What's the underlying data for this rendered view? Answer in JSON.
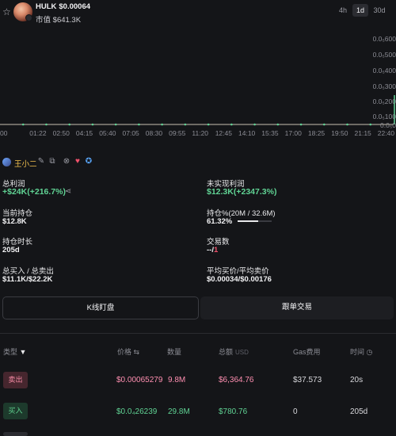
{
  "header": {
    "ticker": "HULK",
    "price": "$0.00064",
    "market_cap_label": "市值",
    "market_cap": "$641.3K",
    "timeframes": [
      "4h",
      "1d",
      "30d"
    ],
    "active_timeframe": "1d"
  },
  "chart_data": {
    "type": "line",
    "title": "",
    "x_ticks": [
      "00",
      "01:22",
      "02:50",
      "04:15",
      "05:40",
      "07:05",
      "08:30",
      "09:55",
      "11:20",
      "12:45",
      "14:10",
      "15:35",
      "17:00",
      "18:25",
      "19:50",
      "21:15",
      "22:40"
    ],
    "y_ticks": [
      "0.0₅600",
      "0.0₅500",
      "0.0₅400",
      "0.0₅300",
      "0.0₅200",
      "0.0₅100",
      "0.0₅0"
    ],
    "series": [
      {
        "values": [
          0,
          0,
          0,
          0,
          0,
          0,
          0,
          0,
          0,
          0,
          0,
          0,
          0,
          0,
          0,
          0,
          0,
          0
        ]
      }
    ],
    "grid": false,
    "line_color": "#60d394"
  },
  "trader": {
    "name": "王小二"
  },
  "stats": {
    "total_pnl_label": "总利润",
    "total_pnl": "+$24K(+216.7%)",
    "unrealized_label": "未实现利润",
    "unrealized": "$12.3K(+2347.3%)",
    "holding_label": "当前持仓",
    "holding": "$12.8K",
    "holding_pct_label": "持仓%(20M / 32.6M)",
    "holding_pct": "61.32%",
    "holding_fraction": 0.6132,
    "duration_label": "持仓时长",
    "duration": "205d",
    "trades_label": "交易数",
    "trades_buys": "--",
    "trades_sep": "/",
    "trades_sells": "1",
    "buy_sell_total_label": "总买入 / 总卖出",
    "buy_sell_total": "$11.1K/$22.2K",
    "avg_price_label": "平均买价/平均卖价",
    "avg_price": "$0.00034/$0.00176"
  },
  "buttons": {
    "kline": "K线盯盘",
    "copy_trade": "跟单交易"
  },
  "table": {
    "headers": {
      "type": "类型",
      "price": "价格",
      "amount": "数量",
      "total": "总额",
      "total_unit": "USD",
      "gas": "Gas费用",
      "time": "时间"
    },
    "rows": [
      {
        "type": "卖出",
        "side": "sell",
        "price": "$0.00065279",
        "amount": "9.8M",
        "total": "$6,364.76",
        "gas": "$37.573",
        "time": "20s"
      },
      {
        "type": "买入",
        "side": "buy",
        "price": "$0.0₄26239",
        "amount": "29.8M",
        "total": "$780.76",
        "gas": "0",
        "time": "205d"
      }
    ]
  }
}
